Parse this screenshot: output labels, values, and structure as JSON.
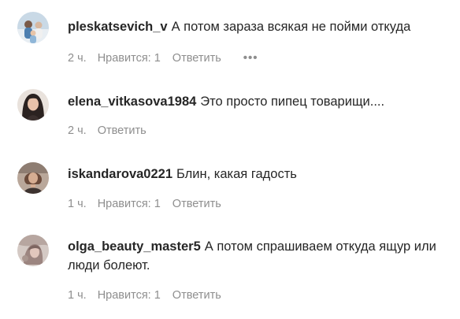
{
  "comments": [
    {
      "username": "pleskatsevich_v",
      "text": "А потом зараза всякая не пойми откуда",
      "time": "2 ч.",
      "likes": "Нравится: 1",
      "reply": "Ответить",
      "more": "•••"
    },
    {
      "username": "elena_vitkasova1984",
      "text": "Это просто пипец товарищи....",
      "time": "2 ч.",
      "reply": "Ответить"
    },
    {
      "username": "iskandarova0221",
      "text": "Блин, какая гадость",
      "time": "1 ч.",
      "likes": "Нравится: 1",
      "reply": "Ответить"
    },
    {
      "username": "olga_beauty_master5",
      "text": "А потом спрашиваем откуда ящур или люди болеют.",
      "time": "1 ч.",
      "likes": "Нравится: 1",
      "reply": "Ответить"
    }
  ]
}
